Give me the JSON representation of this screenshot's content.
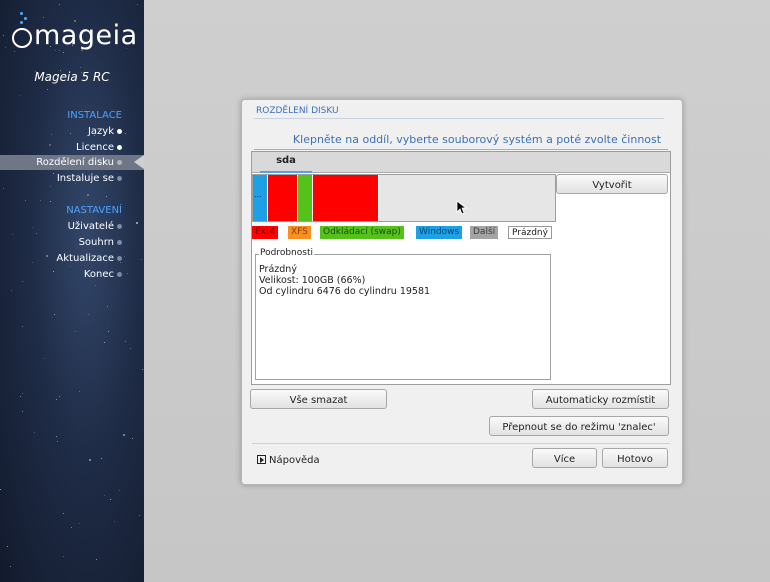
{
  "sidebar": {
    "logo_text": "mageia",
    "release": "Mageia 5 RC",
    "sections": [
      {
        "title": "INSTALACE",
        "items": [
          {
            "label": "Jazyk",
            "state": "done"
          },
          {
            "label": "Licence",
            "state": "done"
          },
          {
            "label": "Rozdělení disku",
            "state": "active"
          },
          {
            "label": "Instaluje se",
            "state": "pending"
          }
        ]
      },
      {
        "title": "NASTAVENÍ",
        "items": [
          {
            "label": "Uživatelé",
            "state": "pending"
          },
          {
            "label": "Souhrn",
            "state": "pending"
          },
          {
            "label": "Aktualizace",
            "state": "pending"
          },
          {
            "label": "Konec",
            "state": "pending"
          }
        ]
      }
    ]
  },
  "panel": {
    "section_title": "ROZDĚLENÍ DISKU",
    "instruction": "Klepněte na oddíl, vyberte souborový systém a poté zvolte činnost",
    "tab": "sda",
    "partitions": [
      {
        "type": "windows",
        "color": "#1ea0e6",
        "label": "...",
        "fraction": 0.05
      },
      {
        "type": "ext4",
        "color": "#ff0000",
        "label": "",
        "fraction": 0.1
      },
      {
        "type": "swap",
        "color": "#55c21b",
        "label": "",
        "fraction": 0.05
      },
      {
        "type": "ext4",
        "color": "#ff0000",
        "label": "",
        "fraction": 0.22
      },
      {
        "type": "empty",
        "color": "#e6e6e6",
        "label": "",
        "fraction": 0.58
      }
    ],
    "create_button": "Vytvořit",
    "legend": [
      {
        "label": "Ext4",
        "bg": "#ff0000",
        "fg": "#7a0000"
      },
      {
        "label": "XFS",
        "bg": "#f7901e",
        "fg": "#8a3c00"
      },
      {
        "label": "Odkládací (swap)",
        "bg": "#55c21b",
        "fg": "#1d4d00"
      },
      {
        "label": "Windows",
        "bg": "#1ea0e6",
        "fg": "#084a72"
      },
      {
        "label": "Další",
        "bg": "#a4a4a4",
        "fg": "#3c3c3c"
      },
      {
        "label": "Prázdný",
        "bg": "#ffffff",
        "fg": "#222222"
      }
    ],
    "details": {
      "legend": "Podrobnosti",
      "lines": [
        "Prázdný",
        "Velikost: 100GB (66%)",
        "Od cylindru 6476 do cylindru 19581"
      ]
    },
    "buttons": {
      "clear_all": "Vše smazat",
      "auto_allocate": "Automaticky rozmístit",
      "expert_mode": "Přepnout se do režimu 'znalec'",
      "more": "Více",
      "done": "Hotovo"
    },
    "help": "Nápověda"
  }
}
